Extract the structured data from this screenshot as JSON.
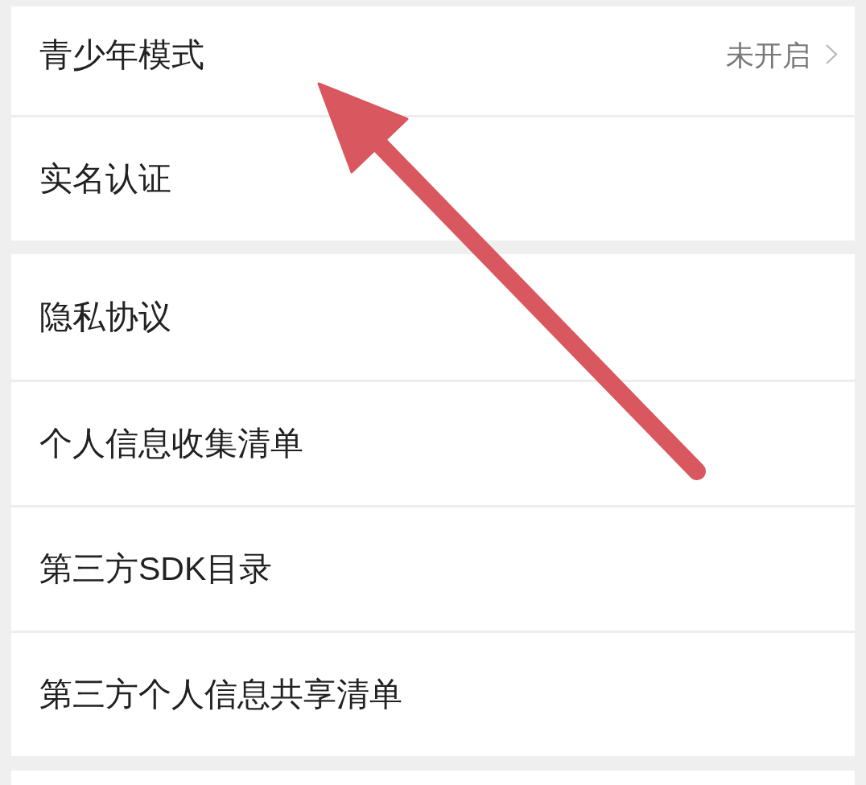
{
  "sections": [
    {
      "rows": [
        {
          "kind": "detail",
          "label": "青少年模式",
          "value": "未开启"
        },
        {
          "kind": "plain",
          "label": "实名认证"
        }
      ]
    },
    {
      "rows": [
        {
          "kind": "plain",
          "label": "隐私协议"
        },
        {
          "kind": "plain",
          "label": "个人信息收集清单"
        },
        {
          "kind": "plain",
          "label": "第三方SDK目录"
        },
        {
          "kind": "plain",
          "label": "第三方个人信息共享清单"
        }
      ]
    }
  ],
  "annotations": [
    {
      "kind": "arrow"
    }
  ]
}
